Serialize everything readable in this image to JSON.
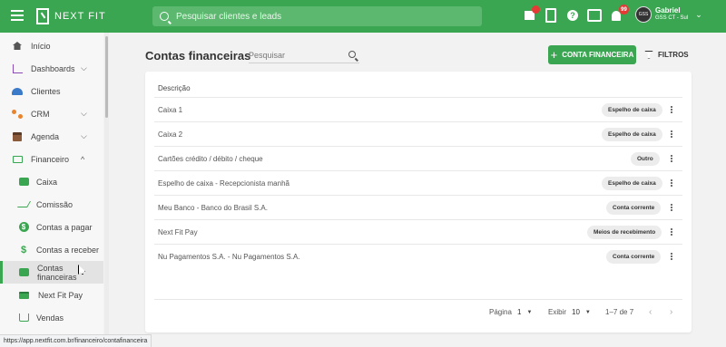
{
  "app": {
    "brand": "NEXT FIT",
    "search_placeholder": "Pesquisar clientes e leads",
    "notifications_count": "99",
    "user": {
      "name": "Gabriel",
      "subtitle": "GSS CT - Sul",
      "avatar_text": "GSS"
    }
  },
  "colors": {
    "accent": "#3aa651",
    "badge": "#e53935"
  },
  "sidebar": {
    "items": [
      {
        "label": "Início",
        "icon": "home-icon"
      },
      {
        "label": "Dashboards",
        "icon": "chart-icon",
        "expandable": true
      },
      {
        "label": "Clientes",
        "icon": "people-icon"
      },
      {
        "label": "CRM",
        "icon": "crm-icon",
        "expandable": true
      },
      {
        "label": "Agenda",
        "icon": "calendar-icon",
        "expandable": true
      },
      {
        "label": "Financeiro",
        "icon": "money-icon",
        "expanded": true
      },
      {
        "label": "Caixa",
        "icon": "wallet-icon"
      },
      {
        "label": "Comissão",
        "icon": "trend-icon"
      },
      {
        "label": "Contas a pagar",
        "icon": "coin-icon"
      },
      {
        "label": "Contas a receber",
        "icon": "dollar-icon"
      },
      {
        "label": "Contas financeiras",
        "icon": "wallet-icon",
        "active": true
      },
      {
        "label": "Next Fit Pay",
        "icon": "card-icon"
      },
      {
        "label": "Vendas",
        "icon": "cart-icon"
      }
    ]
  },
  "main": {
    "title": "Contas financeiras",
    "search_placeholder": "Pesquisar",
    "new_button": "CONTA FINANCEIRA",
    "filter_button": "FILTROS",
    "table": {
      "header": "Descrição",
      "rows": [
        {
          "description": "Caixa 1",
          "type": "Espelho de caixa"
        },
        {
          "description": "Caixa 2",
          "type": "Espelho de caixa"
        },
        {
          "description": "Cartões crédito / débito / cheque",
          "type": "Outro"
        },
        {
          "description": "Espelho de caixa - Recepcionista manhã",
          "type": "Espelho de caixa"
        },
        {
          "description": "Meu Banco - Banco do Brasil S.A.",
          "type": "Conta corrente"
        },
        {
          "description": "Next Fit Pay",
          "type": "Meios de recebimento"
        },
        {
          "description": "Nu Pagamentos S.A. - Nu Pagamentos S.A.",
          "type": "Conta corrente"
        }
      ]
    },
    "pagination": {
      "page_label": "Página",
      "page": "1",
      "show_label": "Exibir",
      "page_size": "10",
      "range": "1–7 de 7"
    }
  },
  "status_url": "https://app.nextfit.com.br/financeiro/contafinanceira"
}
